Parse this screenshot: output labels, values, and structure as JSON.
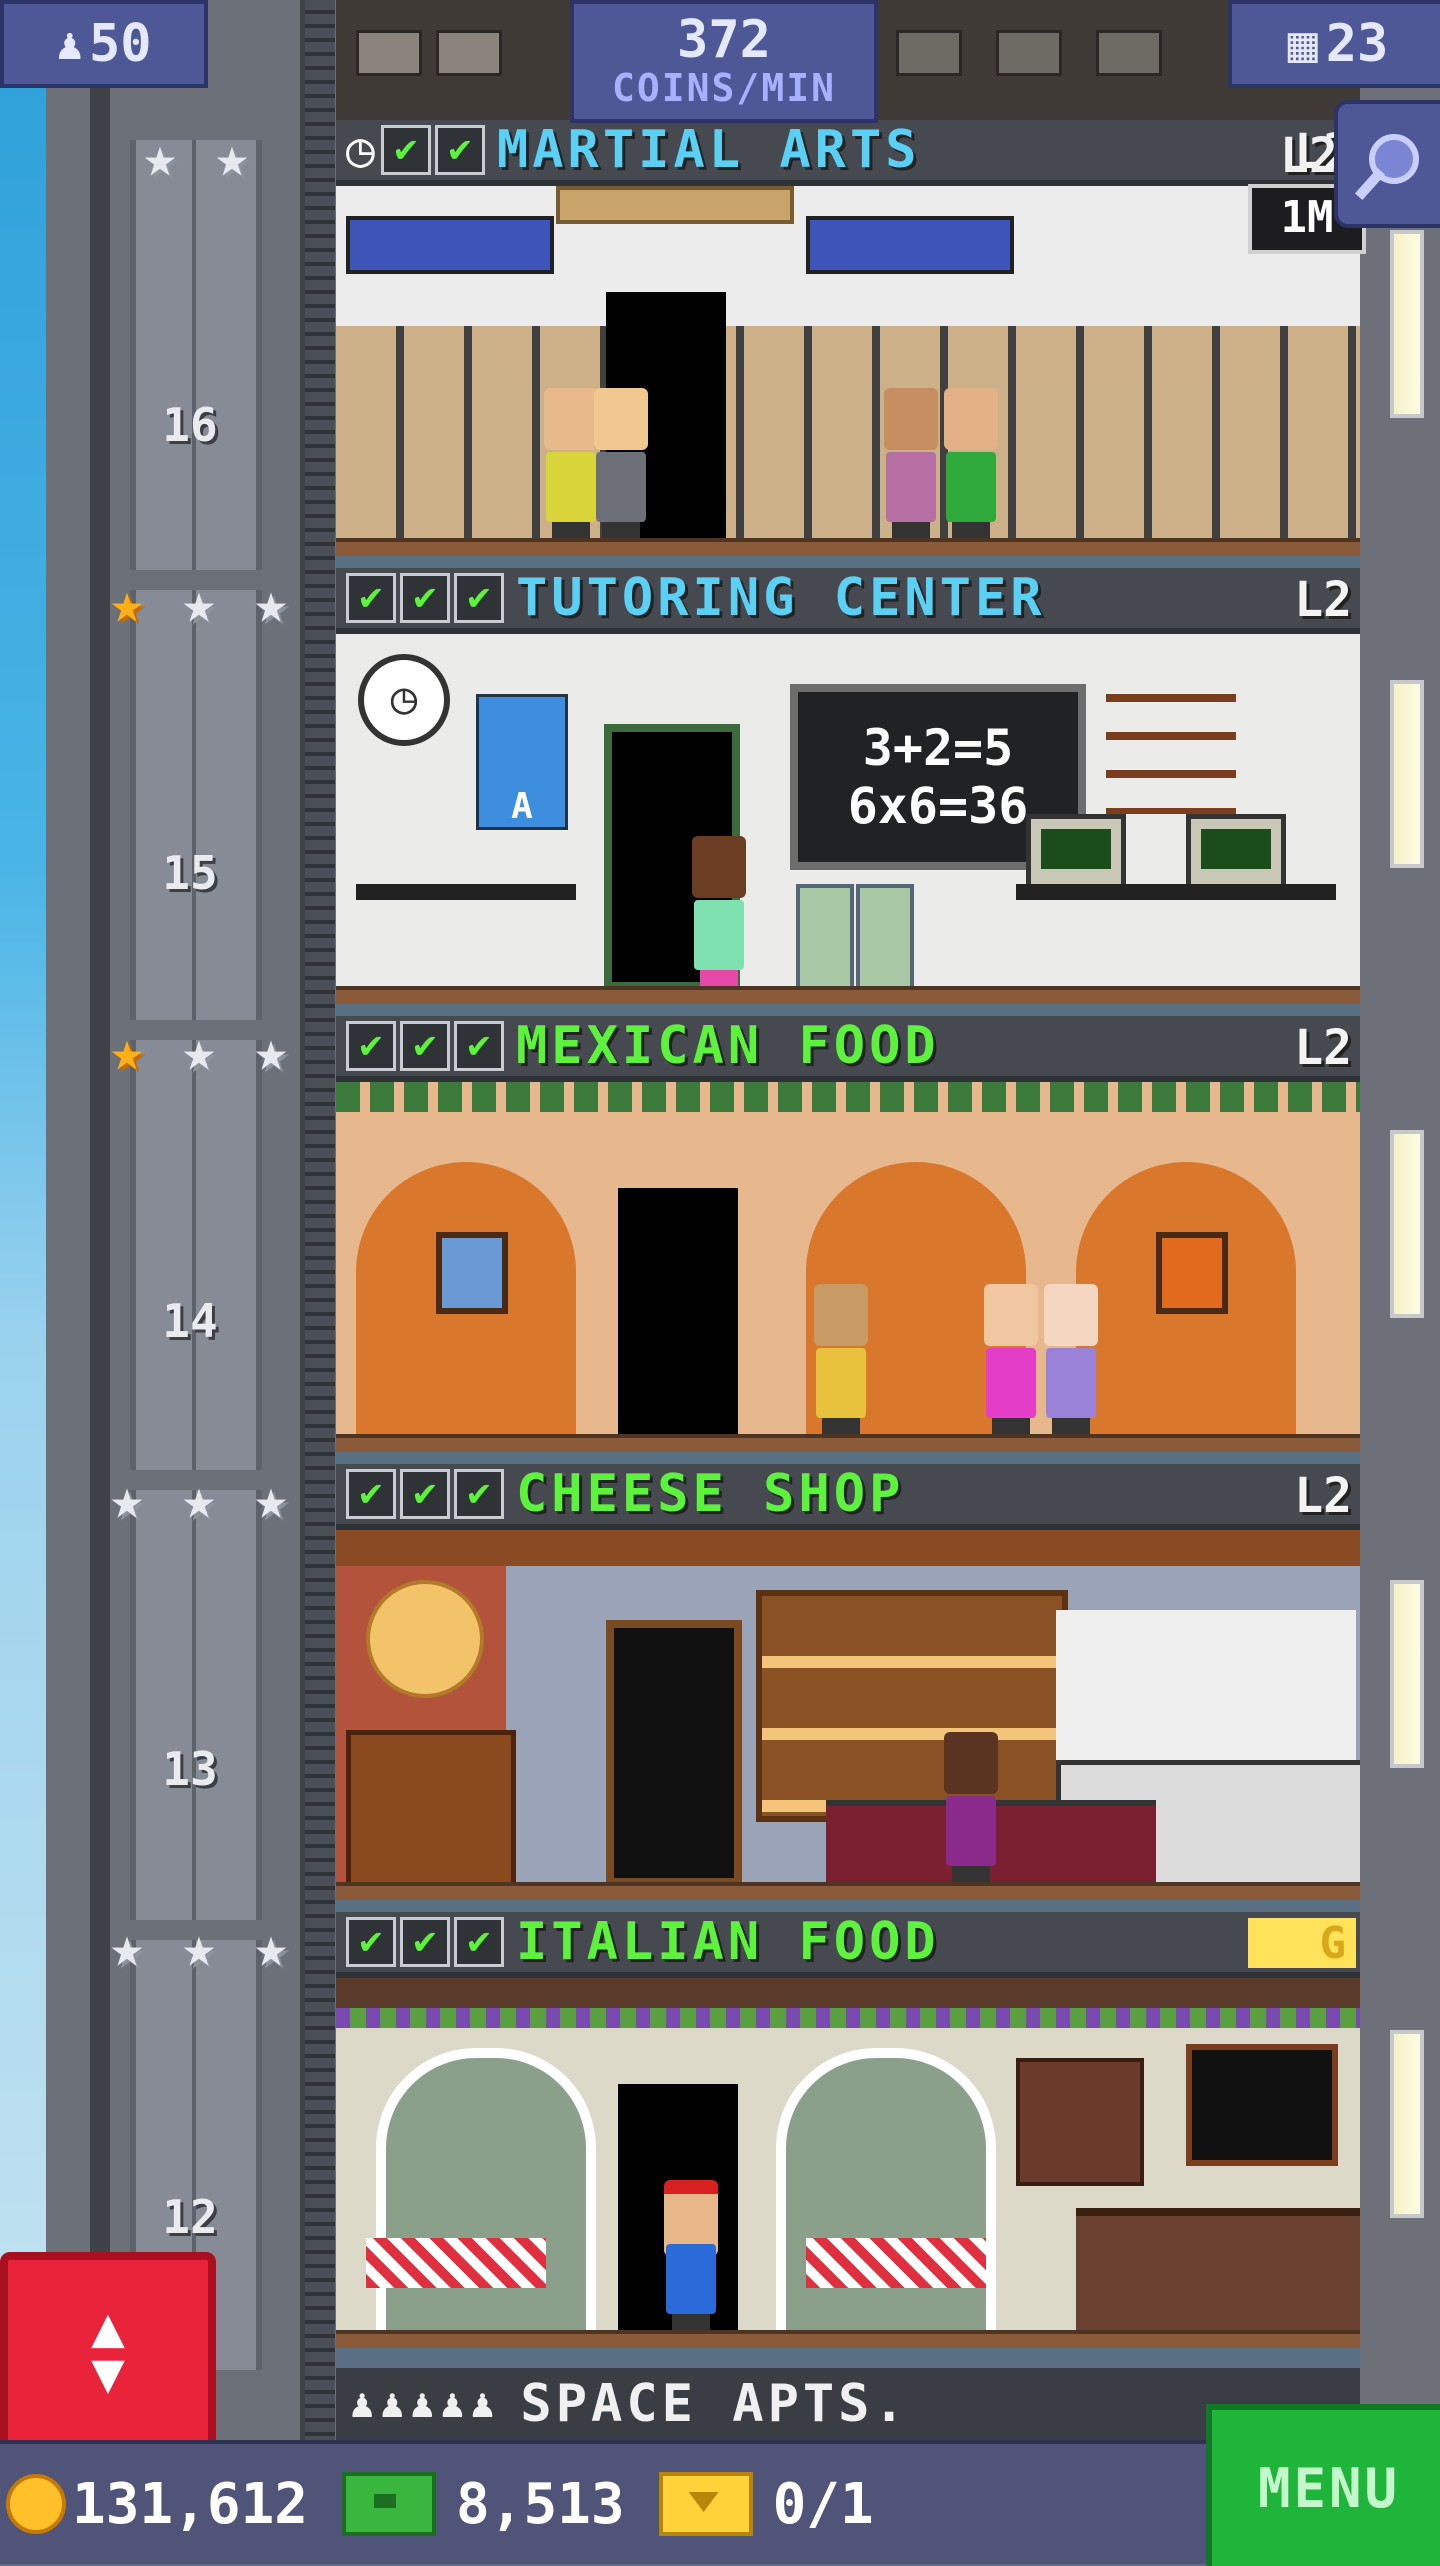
{
  "hud": {
    "population": "50",
    "coins_per_min_value": "372",
    "coins_per_min_label": "COINS/MIN",
    "floor_count": "23"
  },
  "top_floor": {
    "level_partial": "L2",
    "badge_partial": "1M"
  },
  "floors": [
    {
      "number": "16",
      "name": "MARTIAL ARTS",
      "level": "L2",
      "name_color": "#5ad0f5",
      "stars": [
        "silver",
        "silver"
      ],
      "checks": 3,
      "has_clock": true
    },
    {
      "number": "15",
      "name": "TUTORING CENTER",
      "level": "L2",
      "name_color": "#5ad0f5",
      "stars": [
        "gold",
        "silver",
        "silver"
      ],
      "checks": 3
    },
    {
      "number": "14",
      "name": "MEXICAN FOOD",
      "level": "L2",
      "name_color": "#5df23c",
      "stars": [
        "gold",
        "silver",
        "silver"
      ],
      "checks": 3
    },
    {
      "number": "13",
      "name": "CHEESE SHOP",
      "level": "L2",
      "name_color": "#5df23c",
      "stars": [
        "silver",
        "silver",
        "silver"
      ],
      "checks": 3
    },
    {
      "number": "12",
      "name": "ITALIAN FOOD",
      "level": "G",
      "name_color": "#5df23c",
      "stars": [
        "silver",
        "silver",
        "silver"
      ],
      "checks": 3
    }
  ],
  "tutoring_chalkboard": [
    "3+2=5",
    "6x6=36"
  ],
  "tutoring_poster_letter": "A",
  "bottom_floor": {
    "name": "SPACE APTS.",
    "residents_icon": "♟♟♟♟♟"
  },
  "bottom_bar": {
    "coins": "131,612",
    "bux": "8,513",
    "tickets": "0/1",
    "menu_label": "MENU"
  },
  "icons": {
    "search": "magnifier-icon",
    "elevator": "elevator-updown-icon"
  },
  "glyphs": {
    "population_icon": "♟",
    "floors_icon": "▦",
    "check": "✔",
    "star": "★",
    "clock": "◷",
    "elevator_up": "▲",
    "elevator_down": "▼"
  },
  "colors": {
    "hud_blue": "#4f5896",
    "elevator_button": "#e8233a",
    "menu_button": "#1fb43a",
    "star_gold": "#ffb018",
    "check_green": "#5df23c"
  }
}
